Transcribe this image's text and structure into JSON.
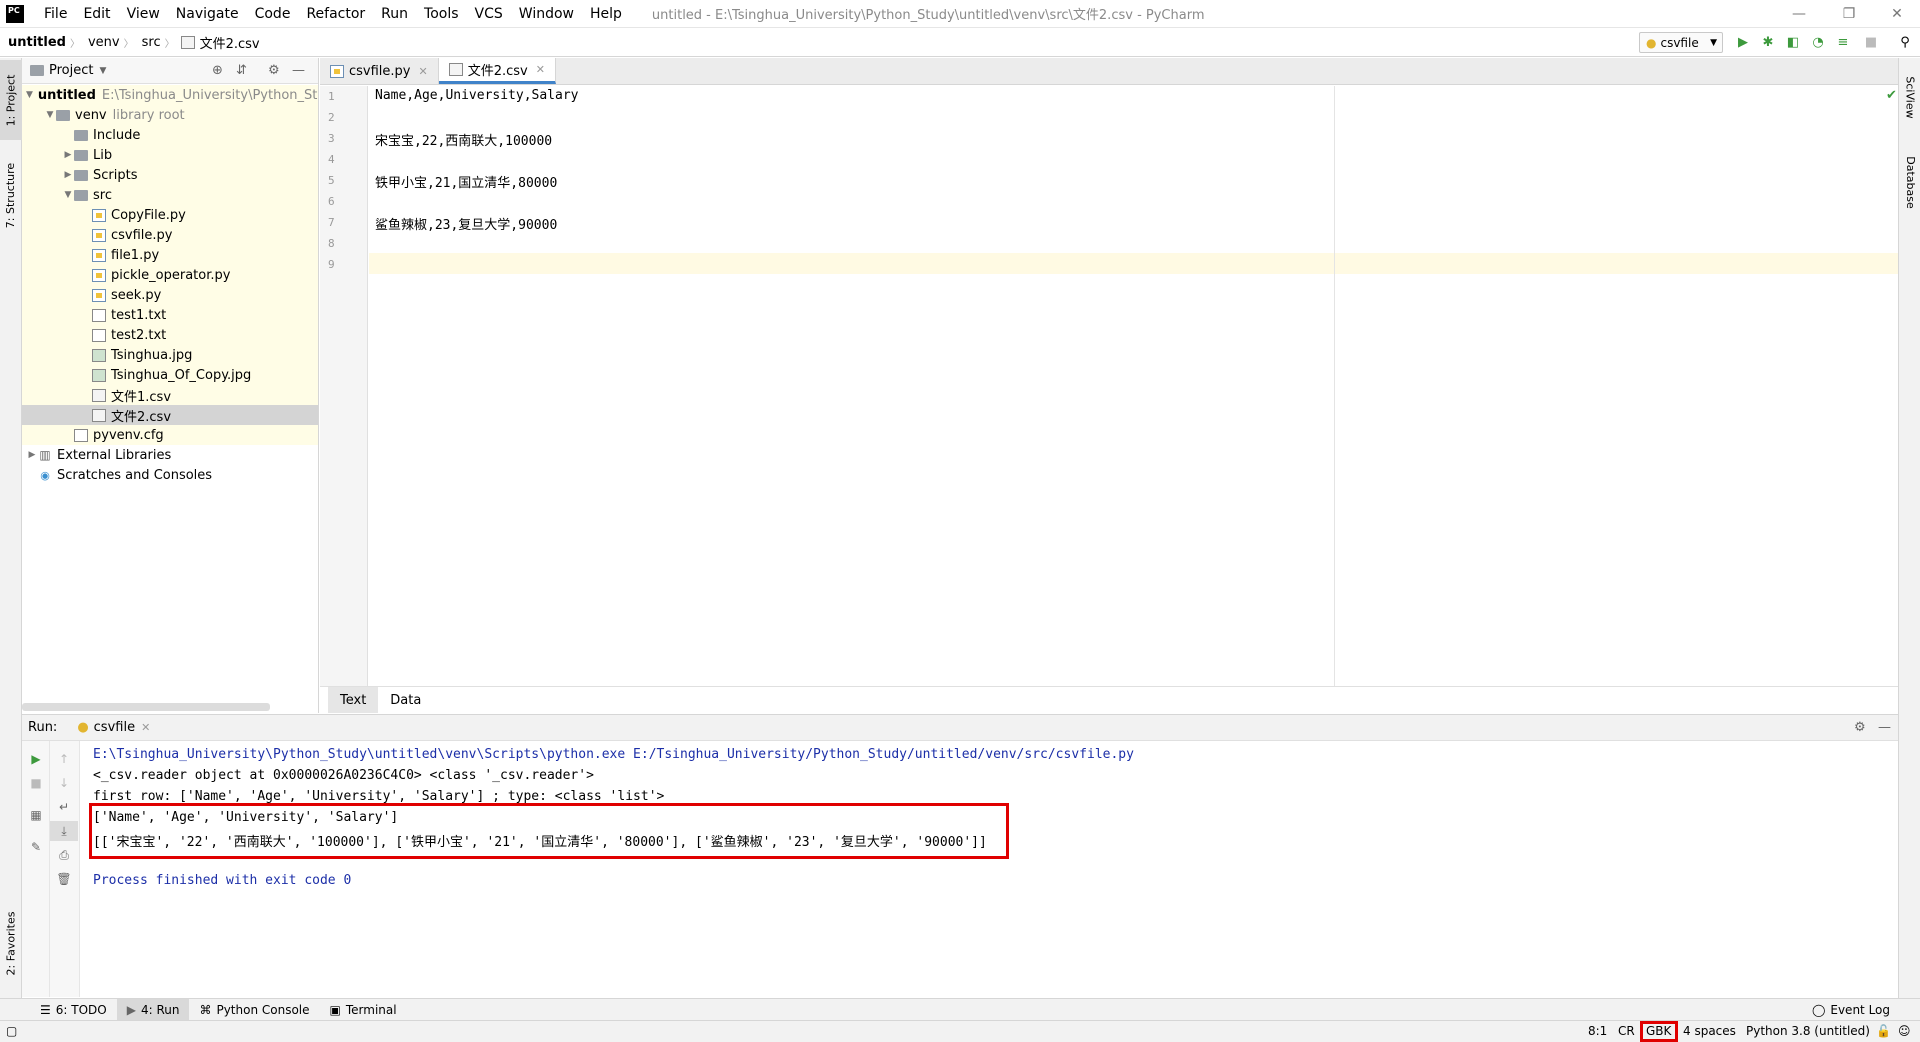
{
  "app": {
    "logo": "PC",
    "window_title": "untitled - E:\\Tsinghua_University\\Python_Study\\untitled\\venv\\src\\文件2.csv - PyCharm"
  },
  "menu": [
    "File",
    "Edit",
    "View",
    "Navigate",
    "Code",
    "Refactor",
    "Run",
    "Tools",
    "VCS",
    "Window",
    "Help"
  ],
  "breadcrumb": [
    "untitled",
    "venv",
    "src",
    "文件2.csv"
  ],
  "run_config": "csvfile",
  "left_strip": {
    "project": "1: Project",
    "structure": "7: Structure",
    "favorites": "2: Favorites"
  },
  "right_strip": {
    "sciview": "SciView",
    "database": "Database"
  },
  "project_panel": {
    "title": "Project",
    "tree": [
      {
        "label": "untitled",
        "hint": "E:\\Tsinghua_University\\Python_Stud",
        "level": 0,
        "icon": "folder-icon",
        "arrow": "open",
        "bold": true
      },
      {
        "label": "venv",
        "hint": "library root",
        "level": 1,
        "icon": "folder-icon",
        "arrow": "open"
      },
      {
        "label": "Include",
        "hint": "",
        "level": 2,
        "icon": "folder-icon",
        "arrow": "none"
      },
      {
        "label": "Lib",
        "hint": "",
        "level": 2,
        "icon": "folder-icon",
        "arrow": "closed"
      },
      {
        "label": "Scripts",
        "hint": "",
        "level": 2,
        "icon": "folder-icon",
        "arrow": "closed"
      },
      {
        "label": "src",
        "hint": "",
        "level": 2,
        "icon": "folder-icon",
        "arrow": "open"
      },
      {
        "label": "CopyFile.py",
        "hint": "",
        "level": 3,
        "icon": "python-file-icon",
        "arrow": "none"
      },
      {
        "label": "csvfile.py",
        "hint": "",
        "level": 3,
        "icon": "python-file-icon",
        "arrow": "none"
      },
      {
        "label": "file1.py",
        "hint": "",
        "level": 3,
        "icon": "python-file-icon",
        "arrow": "none"
      },
      {
        "label": "pickle_operator.py",
        "hint": "",
        "level": 3,
        "icon": "python-file-icon",
        "arrow": "none"
      },
      {
        "label": "seek.py",
        "hint": "",
        "level": 3,
        "icon": "python-file-icon",
        "arrow": "none"
      },
      {
        "label": "test1.txt",
        "hint": "",
        "level": 3,
        "icon": "text-file-icon",
        "arrow": "none"
      },
      {
        "label": "test2.txt",
        "hint": "",
        "level": 3,
        "icon": "text-file-icon",
        "arrow": "none"
      },
      {
        "label": "Tsinghua.jpg",
        "hint": "",
        "level": 3,
        "icon": "image-file-icon",
        "arrow": "none"
      },
      {
        "label": "Tsinghua_Of_Copy.jpg",
        "hint": "",
        "level": 3,
        "icon": "image-file-icon",
        "arrow": "none"
      },
      {
        "label": "文件1.csv",
        "hint": "",
        "level": 3,
        "icon": "csv-file-icon",
        "arrow": "none"
      },
      {
        "label": "文件2.csv",
        "hint": "",
        "level": 3,
        "icon": "csv-file-icon",
        "arrow": "none",
        "selected": true
      },
      {
        "label": "pyvenv.cfg",
        "hint": "",
        "level": 2,
        "icon": "config-file-icon",
        "arrow": "none"
      },
      {
        "label": "External Libraries",
        "hint": "",
        "level": 0,
        "icon": "library-icon",
        "arrow": "closed",
        "plain": true
      },
      {
        "label": "Scratches and Consoles",
        "hint": "",
        "level": 0,
        "icon": "scratches-icon",
        "arrow": "none",
        "plain": true
      }
    ]
  },
  "editor": {
    "tabs": [
      {
        "label": "csvfile.py",
        "active": false
      },
      {
        "label": "文件2.csv",
        "active": true
      }
    ],
    "line_numbers": [
      "1",
      "2",
      "3",
      "4",
      "5",
      "6",
      "7",
      "8",
      "9"
    ],
    "lines": [
      "Name,Age,University,Salary",
      "",
      "宋宝宝,22,西南联大,100000",
      "",
      "铁甲小宝,21,国立清华,80000",
      "",
      "鲨鱼辣椒,23,复旦大学,90000",
      "",
      ""
    ],
    "bottom_tabs": [
      {
        "label": "Text",
        "active": true
      },
      {
        "label": "Data",
        "active": false
      }
    ]
  },
  "run_panel": {
    "label": "Run:",
    "tab": "csvfile",
    "output": [
      {
        "text": "E:\\Tsinghua_University\\Python_Study\\untitled\\venv\\Scripts\\python.exe E:/Tsinghua_University/Python_Study/untitled/venv/src/csvfile.py",
        "color": "blue"
      },
      {
        "text": "<_csv.reader object at 0x0000026A0236C4C0> <class '_csv.reader'>",
        "color": "black"
      },
      {
        "text": "first row: ['Name', 'Age', 'University', 'Salary'] ; type: <class 'list'>",
        "color": "black"
      },
      {
        "text": "['Name', 'Age', 'University', 'Salary']",
        "color": "black"
      },
      {
        "text": "[['宋宝宝', '22', '西南联大', '100000'], ['铁甲小宝', '21', '国立清华', '80000'], ['鲨鱼辣椒', '23', '复旦大学', '90000']]",
        "color": "black"
      },
      {
        "text": "",
        "color": "black"
      },
      {
        "text": "Process finished with exit code 0",
        "color": "blue"
      }
    ]
  },
  "bottom_tabs": [
    "6: TODO",
    "4: Run",
    "Python Console",
    "Terminal"
  ],
  "event_log": "Event Log",
  "status": {
    "position": "8:1",
    "line_sep": "CR",
    "encoding": "GBK",
    "indent": "4 spaces",
    "interpreter": "Python 3.8 (untitled)"
  },
  "colors": {
    "accent": "#4083c9",
    "highlight": "#e00000",
    "run_green": "#3d9a3d",
    "console_blue": "#1c2fa8"
  }
}
